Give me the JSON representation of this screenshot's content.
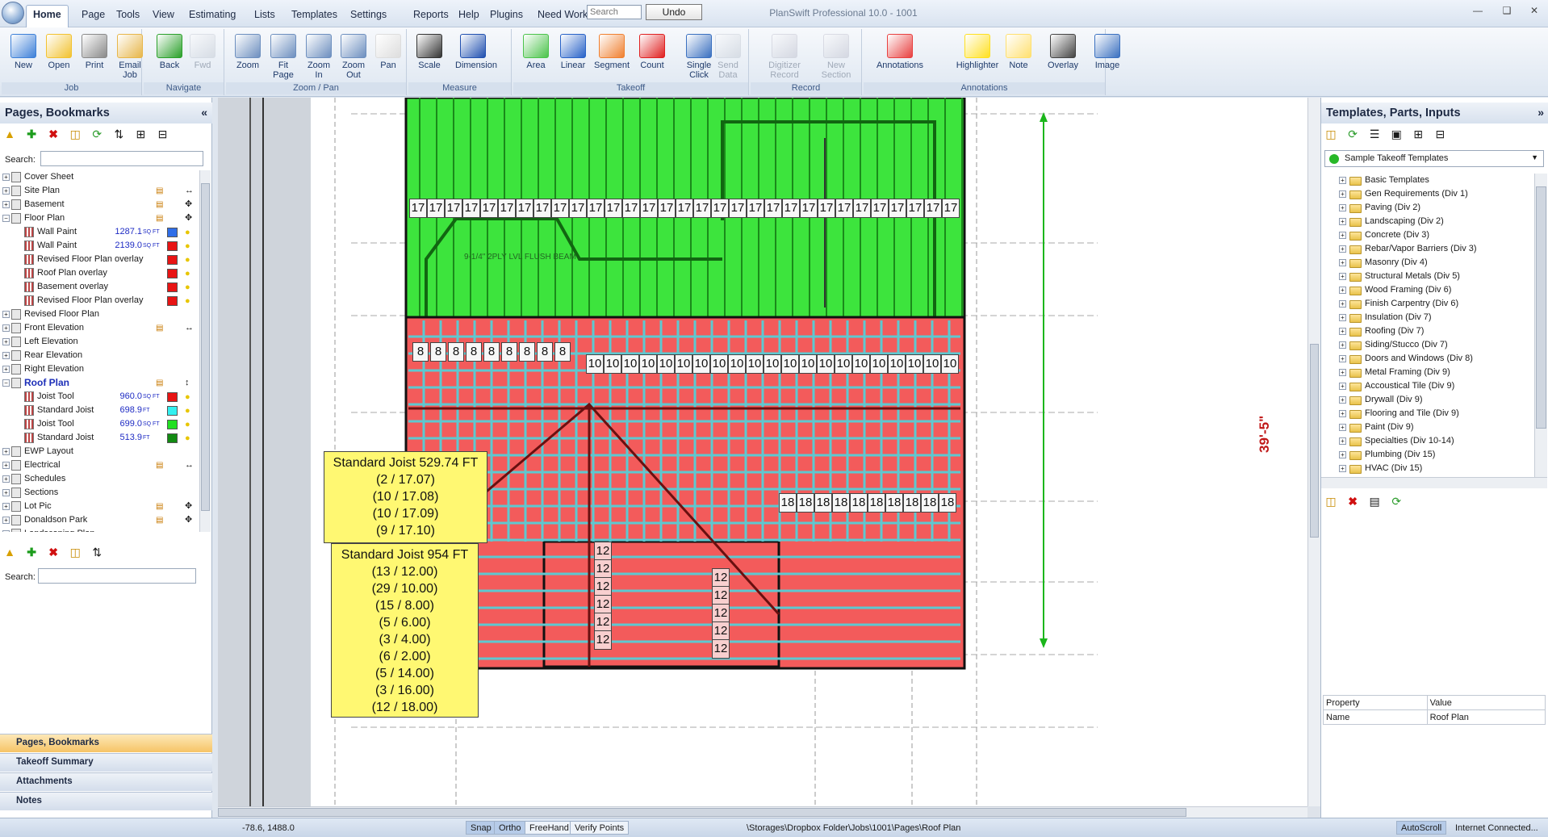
{
  "window": {
    "title": "PlanSwift Professional 10.0 - 1001"
  },
  "menu": {
    "tabs": [
      "Home",
      "Page",
      "Tools",
      "View",
      "Estimating",
      "Lists",
      "Templates",
      "Settings",
      "Reports",
      "Help",
      "Plugins",
      "Need Work?"
    ],
    "search_placeholder": "Search",
    "undo_label": "Undo"
  },
  "ribbon": {
    "groups": [
      {
        "label": "Job",
        "buttons": [
          "New",
          "Open",
          "Print",
          "Email\nJob"
        ]
      },
      {
        "label": "Navigate",
        "buttons": [
          "Back",
          "Fwd"
        ]
      },
      {
        "label": "Zoom / Pan",
        "buttons": [
          "Zoom",
          "Fit\nPage",
          "Zoom\nIn",
          "Zoom\nOut",
          "Pan"
        ]
      },
      {
        "label": "Measure",
        "buttons": [
          "Scale",
          "Dimension"
        ]
      },
      {
        "label": "Takeoff",
        "buttons": [
          "Area",
          "Linear",
          "Segment",
          "Count",
          "Single\nClick",
          "Send\nData"
        ]
      },
      {
        "label": "Record",
        "buttons": [
          "Digitizer\nRecord",
          "New\nSection"
        ]
      },
      {
        "label": "Annotations",
        "buttons": [
          "Annotations",
          "Highlighter",
          "Note",
          "Overlay",
          "Image"
        ]
      }
    ]
  },
  "left_panel": {
    "title": "Pages, Bookmarks",
    "search_label": "Search:",
    "tree": [
      {
        "label": "Cover Sheet"
      },
      {
        "label": "Site Plan"
      },
      {
        "label": "Basement"
      },
      {
        "label": "Floor Plan"
      },
      {
        "label": "Wall Paint",
        "qty": "1287.1",
        "unit": "SQ FT",
        "color": "#2f6ee8"
      },
      {
        "label": "Wall Paint",
        "qty": "2139.0",
        "unit": "SQ FT",
        "color": "#e81414"
      },
      {
        "label": "Revised Floor Plan overlay",
        "color": "#e81414"
      },
      {
        "label": "Roof Plan overlay",
        "color": "#e81414"
      },
      {
        "label": "Basement overlay",
        "color": "#e81414"
      },
      {
        "label": "Revised Floor Plan overlay",
        "color": "#e81414"
      },
      {
        "label": "Revised Floor Plan"
      },
      {
        "label": "Front Elevation"
      },
      {
        "label": "Left Elevation"
      },
      {
        "label": "Rear Elevation"
      },
      {
        "label": "Right Elevation"
      },
      {
        "label": "Roof Plan"
      },
      {
        "label": "Joist Tool",
        "qty": "960.0",
        "unit": "SQ FT",
        "color": "#e81414"
      },
      {
        "label": "Standard Joist",
        "qty": "698.9",
        "unit": "FT",
        "color": "#33f0f0"
      },
      {
        "label": "Joist Tool",
        "qty": "699.0",
        "unit": "SQ FT",
        "color": "#22e022"
      },
      {
        "label": "Standard Joist",
        "qty": "513.9",
        "unit": "FT",
        "color": "#128a12"
      },
      {
        "label": "EWP Layout"
      },
      {
        "label": "Electrical"
      },
      {
        "label": "Schedules"
      },
      {
        "label": "Sections"
      },
      {
        "label": "Lot Pic"
      },
      {
        "label": "Donaldson Park"
      },
      {
        "label": "Landscaping Plan"
      }
    ],
    "bottom_tabs": [
      "Pages, Bookmarks",
      "Takeoff Summary",
      "Attachments",
      "Notes"
    ]
  },
  "canvas": {
    "dimension_label": "39'-5\"",
    "beam_label": "9-1/4\" 2PLY LVL FLUSH BEAM",
    "callouts": [
      {
        "title": "Standard Joist 529.74 FT",
        "lines": [
          "(2 / 17.07)",
          "(10 / 17.08)",
          "(10 / 17.09)",
          "(9 / 17.10)"
        ]
      },
      {
        "title": "Standard Joist 954 FT",
        "lines": [
          "(13 / 12.00)",
          "(29 / 10.00)",
          "(15 / 8.00)",
          "(5 / 6.00)",
          "(3 / 4.00)",
          "(6 / 2.00)",
          "(5 / 14.00)",
          "(3 / 16.00)",
          "(12 / 18.00)"
        ]
      }
    ],
    "joist_labels": {
      "row17": "17",
      "row10": "10",
      "row8": "8",
      "row18": "18",
      "row12": "12"
    }
  },
  "right_panel": {
    "title": "Templates, Parts, Inputs",
    "dropdown": "Sample Takeoff Templates",
    "items": [
      "Basic Templates",
      "Gen Requirements (Div 1)",
      "Paving (Div 2)",
      "Landscaping (Div 2)",
      "Concrete (Div 3)",
      "Rebar/Vapor Barriers (Div 3)",
      "Masonry (Div 4)",
      "Structural Metals (Div 5)",
      "Wood Framing (Div 6)",
      "Finish Carpentry (Div 6)",
      "Insulation (Div 7)",
      "Roofing (Div 7)",
      "Siding/Stucco (Div 7)",
      "Doors and Windows (Div 8)",
      "Metal Framing (Div 9)",
      "Accoustical Tile (Div 9)",
      "Drywall (Div 9)",
      "Flooring and Tile (Div 9)",
      "Paint (Div 9)",
      "Specialties (Div 10-14)",
      "Plumbing (Div 15)",
      "HVAC (Div 15)"
    ],
    "property_header": [
      "Property",
      "Value"
    ],
    "property_rows": [
      [
        "Name",
        "Roof Plan"
      ]
    ]
  },
  "statusbar": {
    "coords": "-78.6, 1488.0",
    "snap": "Snap",
    "ortho": "Ortho",
    "freehand": "FreeHand",
    "verify": "Verify Points",
    "path": "\\Storages\\Dropbox Folder\\Jobs\\1001\\Pages\\Roof Plan",
    "autoscroll": "AutoScroll",
    "internet": "Internet Connected..."
  }
}
